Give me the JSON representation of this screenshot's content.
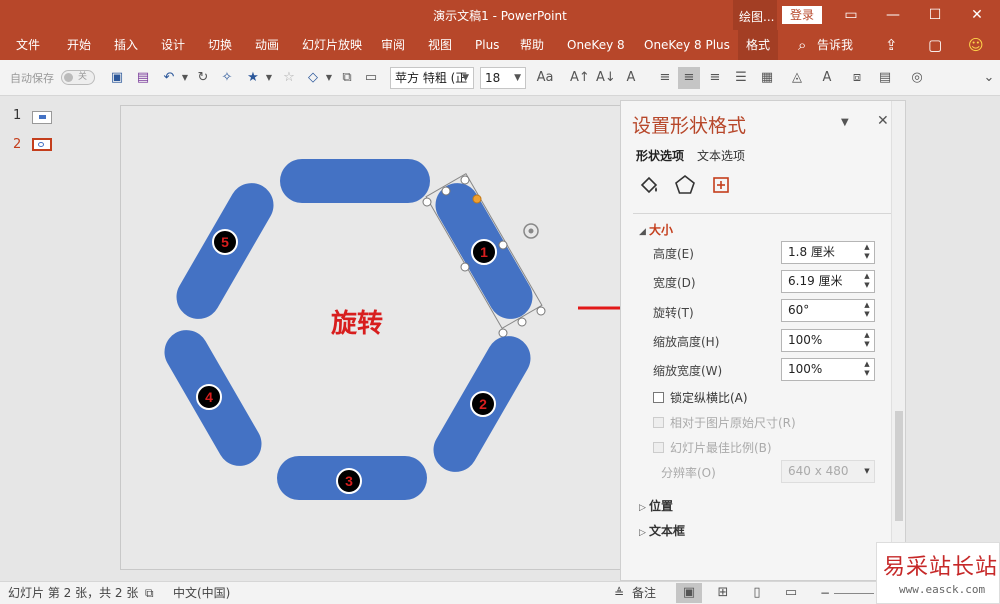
{
  "app": {
    "title": "演示文稿1  -  PowerPoint",
    "context_tab": "绘图...",
    "login": "登录"
  },
  "ribbon": {
    "tabs": [
      "文件",
      "开始",
      "插入",
      "设计",
      "切换",
      "动画",
      "幻灯片放映",
      "审阅",
      "视图",
      "Plus",
      "帮助",
      "OneKey 8",
      "OneKey 8 Plus",
      "格式"
    ],
    "active_tab": "格式",
    "tell_me": "告诉我"
  },
  "toolbar": {
    "autosave_label": "自动保存",
    "autosave_state": "关",
    "font_name": "苹方 特粗 (正",
    "font_size": "18"
  },
  "slides": {
    "numbers": [
      "1",
      "2"
    ],
    "current": "2"
  },
  "slide_content": {
    "center_text": "旋转",
    "shape_labels": [
      "1",
      "2",
      "3",
      "4",
      "5"
    ]
  },
  "pane": {
    "title": "设置形状格式",
    "tabs": [
      "形状选项",
      "文本选项"
    ],
    "size_section": "大小",
    "height_label": "高度(E)",
    "height_value": "1.8 厘米",
    "width_label": "宽度(D)",
    "width_value": "6.19 厘米",
    "rotation_label": "旋转(T)",
    "rotation_value": "60°",
    "scale_h_label": "缩放高度(H)",
    "scale_h_value": "100%",
    "scale_w_label": "缩放宽度(W)",
    "scale_w_value": "100%",
    "lock_aspect": "锁定纵横比(A)",
    "relative_original": "相对于图片原始尺寸(R)",
    "best_scale": "幻灯片最佳比例(B)",
    "resolution_label": "分辨率(O)",
    "resolution_value": "640 x 480",
    "position_section": "位置",
    "textbox_section": "文本框"
  },
  "status": {
    "slide_info": "幻灯片 第 2 张，共 2 张",
    "language": "中文(中国)",
    "notes": "备注"
  },
  "watermark": {
    "line1": "易采站长站",
    "line2": "www.easck.com"
  },
  "colors": {
    "accent": "#b7472a",
    "shape_fill": "#4472c4",
    "arrow": "#e21818",
    "label_red": "#d81e1e"
  }
}
